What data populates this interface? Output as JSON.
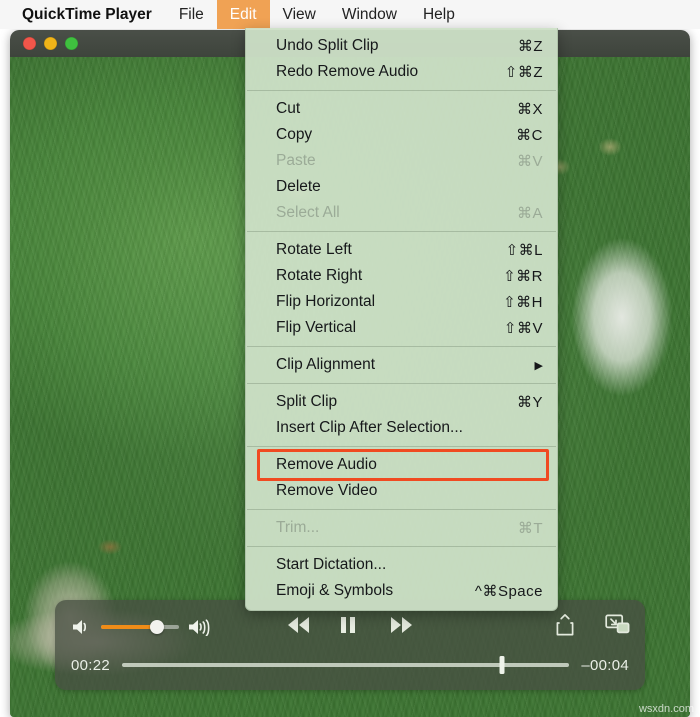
{
  "menubar": {
    "app_name": "QuickTime Player",
    "items": [
      {
        "label": "File",
        "active": false
      },
      {
        "label": "Edit",
        "active": true
      },
      {
        "label": "View",
        "active": false
      },
      {
        "label": "Window",
        "active": false
      },
      {
        "label": "Help",
        "active": false
      }
    ]
  },
  "window": {
    "traffic_lights": {
      "close": "close-button",
      "minimize": "minimize-button",
      "maximize": "maximize-button"
    }
  },
  "edit_menu": {
    "groups": [
      {
        "items": [
          {
            "label": "Undo Split Clip",
            "shortcut": "⌘Z",
            "disabled": false,
            "annotated": false,
            "submenu": false
          },
          {
            "label": "Redo Remove Audio",
            "shortcut": "⇧⌘Z",
            "disabled": false,
            "annotated": false,
            "submenu": false
          }
        ]
      },
      {
        "items": [
          {
            "label": "Cut",
            "shortcut": "⌘X",
            "disabled": false,
            "annotated": false,
            "submenu": false
          },
          {
            "label": "Copy",
            "shortcut": "⌘C",
            "disabled": false,
            "annotated": false,
            "submenu": false
          },
          {
            "label": "Paste",
            "shortcut": "⌘V",
            "disabled": true,
            "annotated": false,
            "submenu": false
          },
          {
            "label": "Delete",
            "shortcut": "",
            "disabled": false,
            "annotated": false,
            "submenu": false
          },
          {
            "label": "Select All",
            "shortcut": "⌘A",
            "disabled": true,
            "annotated": false,
            "submenu": false
          }
        ]
      },
      {
        "items": [
          {
            "label": "Rotate Left",
            "shortcut": "⇧⌘L",
            "disabled": false,
            "annotated": false,
            "submenu": false
          },
          {
            "label": "Rotate Right",
            "shortcut": "⇧⌘R",
            "disabled": false,
            "annotated": false,
            "submenu": false
          },
          {
            "label": "Flip Horizontal",
            "shortcut": "⇧⌘H",
            "disabled": false,
            "annotated": false,
            "submenu": false
          },
          {
            "label": "Flip Vertical",
            "shortcut": "⇧⌘V",
            "disabled": false,
            "annotated": false,
            "submenu": false
          }
        ]
      },
      {
        "items": [
          {
            "label": "Clip Alignment",
            "shortcut": "",
            "disabled": false,
            "annotated": false,
            "submenu": true
          }
        ]
      },
      {
        "items": [
          {
            "label": "Split Clip",
            "shortcut": "⌘Y",
            "disabled": false,
            "annotated": false,
            "submenu": false
          },
          {
            "label": "Insert Clip After Selection...",
            "shortcut": "",
            "disabled": false,
            "annotated": false,
            "submenu": false
          }
        ]
      },
      {
        "items": [
          {
            "label": "Remove Audio",
            "shortcut": "",
            "disabled": false,
            "annotated": true,
            "submenu": false
          },
          {
            "label": "Remove Video",
            "shortcut": "",
            "disabled": false,
            "annotated": false,
            "submenu": false
          }
        ]
      },
      {
        "items": [
          {
            "label": "Trim...",
            "shortcut": "⌘T",
            "disabled": true,
            "annotated": false,
            "submenu": false
          }
        ]
      },
      {
        "items": [
          {
            "label": "Start Dictation...",
            "shortcut": "",
            "disabled": false,
            "annotated": false,
            "submenu": false
          },
          {
            "label": "Emoji & Symbols",
            "shortcut": "^⌘Space",
            "disabled": false,
            "annotated": false,
            "submenu": false
          }
        ]
      }
    ]
  },
  "player": {
    "volume": {
      "level_percent": 72,
      "mute_icon": "volume-low-icon",
      "max_icon": "volume-high-icon"
    },
    "transport": {
      "rewind_icon": "rewind-icon",
      "playpause_icon": "pause-icon",
      "fastforward_icon": "fast-forward-icon"
    },
    "share_icon": "share-icon",
    "pip_icon": "picture-in-picture-icon",
    "elapsed_time": "00:22",
    "remaining_time": "–00:04",
    "progress_percent": 85
  },
  "colors": {
    "menu_highlight": "#f0a254",
    "annotation_box": "#f04a21",
    "volume_fill": "#f08c18",
    "menu_background": "#cee0c7"
  },
  "watermark": "wsxdn.com"
}
